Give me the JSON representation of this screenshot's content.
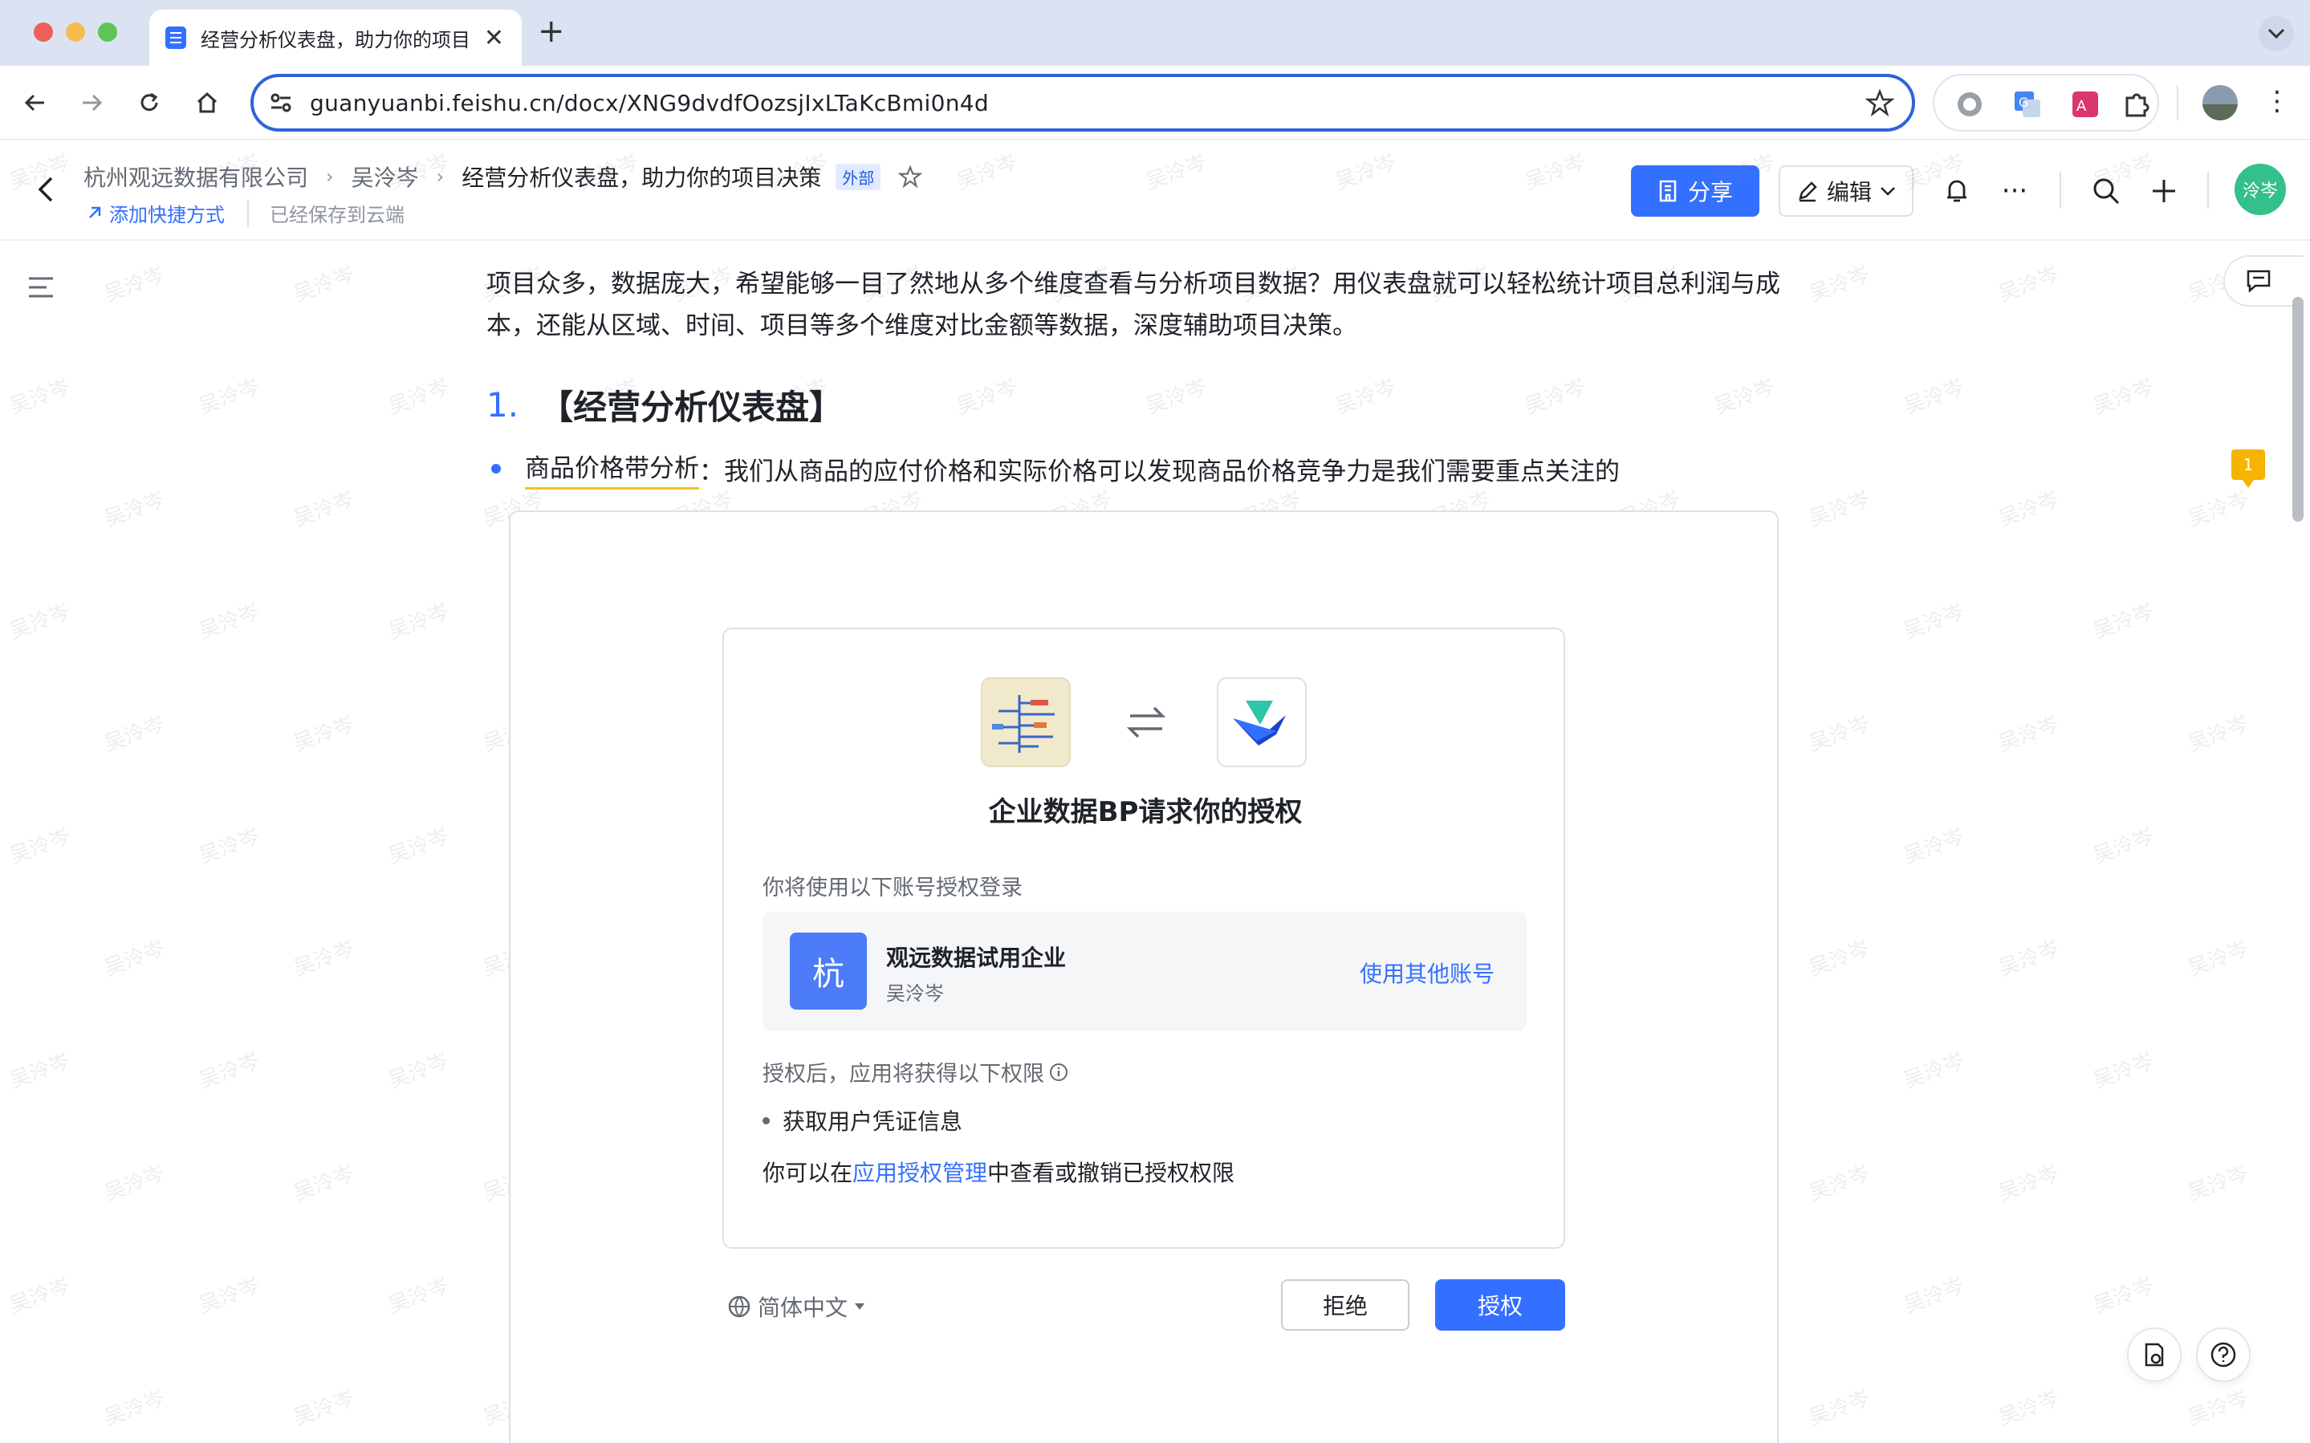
{
  "browser": {
    "tab_title": "经营分析仪表盘，助力你的项目",
    "url": "guanyuanbi.feishu.cn/docx/XNG9dvdfOozsjIxLTaKcBmi0n4d"
  },
  "doc_header": {
    "breadcrumb": [
      "杭州观远数据有限公司",
      "吴泠岑",
      "经营分析仪表盘，助力你的项目决策"
    ],
    "external_badge": "外部",
    "add_shortcut": "添加快捷方式",
    "saved_status": "已经保存到云端",
    "share_label": "分享",
    "edit_label": "编辑",
    "user_avatar": "泠岑"
  },
  "doc": {
    "intro": "项目众多，数据庞大，希望能够一目了然地从多个维度查看与分析项目数据？用仪表盘就可以轻松统计项目总利润与成本，还能从区域、时间、项目等多个维度对比金额等数据，深度辅助项目决策。",
    "heading_number": "1.",
    "heading_text": "【经营分析仪表盘】",
    "bullet_label": "商品价格带分析",
    "bullet_text": "：我们从商品的应付价格和实际价格可以发现商品价格竞争力是我们需要重点关注的",
    "comment_count": "1",
    "watermark_text": "吴泠岑"
  },
  "auth": {
    "title": "企业数据BP请求你的授权",
    "account_label": "你将使用以下账号授权登录",
    "account_avatar": "杭",
    "account_org": "观远数据试用企业",
    "account_user": "吴泠岑",
    "switch_account": "使用其他账号",
    "permissions_intro": "授权后，应用将获得以下权限",
    "permissions": [
      "获取用户凭证信息"
    ],
    "manage_prefix": "你可以在",
    "manage_link": "应用授权管理",
    "manage_suffix": "中查看或撤销已授权权限",
    "language": "简体中文",
    "reject_label": "拒绝",
    "accept_label": "授权"
  },
  "colors": {
    "accent": "#3370ff",
    "highlight_underline": "#f7c31e",
    "comment_badge": "#f5b400",
    "avatar_green": "#34c08a"
  }
}
